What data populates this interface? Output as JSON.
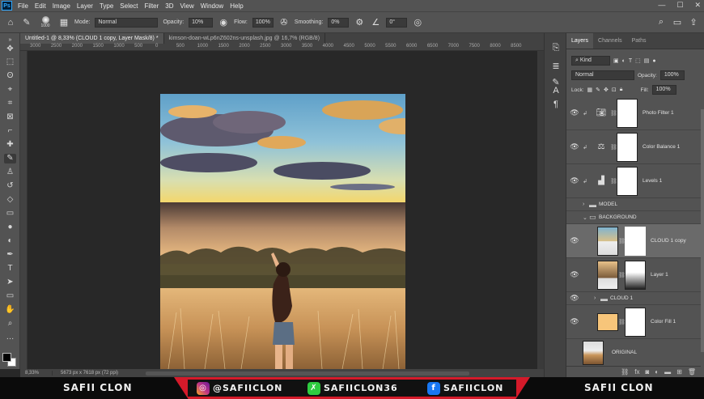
{
  "menu": {
    "app_icon": "Ps",
    "items": [
      "File",
      "Edit",
      "Image",
      "Layer",
      "Type",
      "Select",
      "Filter",
      "3D",
      "View",
      "Window",
      "Help"
    ],
    "window_controls": [
      "—",
      "☐",
      "✕"
    ]
  },
  "options_bar": {
    "brush_size": "1000",
    "mode_label": "Mode:",
    "mode_value": "Normal",
    "opacity_label": "Opacity:",
    "opacity_value": "10%",
    "flow_label": "Flow:",
    "flow_value": "100%",
    "smoothing_label": "Smoothing:",
    "smoothing_value": "0%",
    "angle_value": "0°"
  },
  "document_tabs": [
    {
      "label": "Untitled-1 @ 8,33% (CLOUD 1 copy, Layer Mask/8) *",
      "active": true
    },
    {
      "label": "kimson-doan-wLp6nZ602ns-unsplash.jpg @ 16,7% (RGB/8)",
      "active": false
    }
  ],
  "ruler_ticks": [
    "3000",
    "2500",
    "2000",
    "1500",
    "1000",
    "500",
    "0",
    "500",
    "1000",
    "1500",
    "2000",
    "2500",
    "3000",
    "3500",
    "4000",
    "4500",
    "5000",
    "5500",
    "6000",
    "6500",
    "7000",
    "7500",
    "8000",
    "8500"
  ],
  "status": {
    "zoom": "8,33%",
    "dimensions": "5673 px x 7618 px (72 ppi)"
  },
  "layers_panel": {
    "tabs": [
      "Layers",
      "Channels",
      "Paths"
    ],
    "kind_label": "Kind",
    "blend_mode": "Normal",
    "opacity_label": "Opacity:",
    "opacity_value": "100%",
    "lock_label": "Lock:",
    "fill_label": "Fill:",
    "fill_value": "100%",
    "layers": [
      {
        "name": "Photo Filter 1",
        "type": "adjustment",
        "icon": "camera-icon"
      },
      {
        "name": "Color Balance 1",
        "type": "adjustment",
        "icon": "balance-icon"
      },
      {
        "name": "Levels 1",
        "type": "adjustment",
        "icon": "levels-icon"
      },
      {
        "name": "MODEL",
        "type": "group"
      },
      {
        "name": "BACKGROUND",
        "type": "group-open"
      },
      {
        "name": "CLOUD 1 copy",
        "type": "image-mask"
      },
      {
        "name": "Layer 1",
        "type": "image-mask"
      },
      {
        "name": "CLOUD 1",
        "type": "group"
      },
      {
        "name": "Color Fill 1",
        "type": "fill"
      },
      {
        "name": "ORIGINAL",
        "type": "image"
      }
    ]
  },
  "banner": {
    "left_text": "SAFII CLON",
    "instagram": "@SAFIICLON",
    "kofi": "SAFIICLON36",
    "facebook": "SAFIICLON",
    "right_text": "SAFII CLON",
    "colors": {
      "strip": "#d41a2a",
      "instagram": "#c13584",
      "kofi": "#2ecc40",
      "facebook": "#1877f2"
    }
  }
}
